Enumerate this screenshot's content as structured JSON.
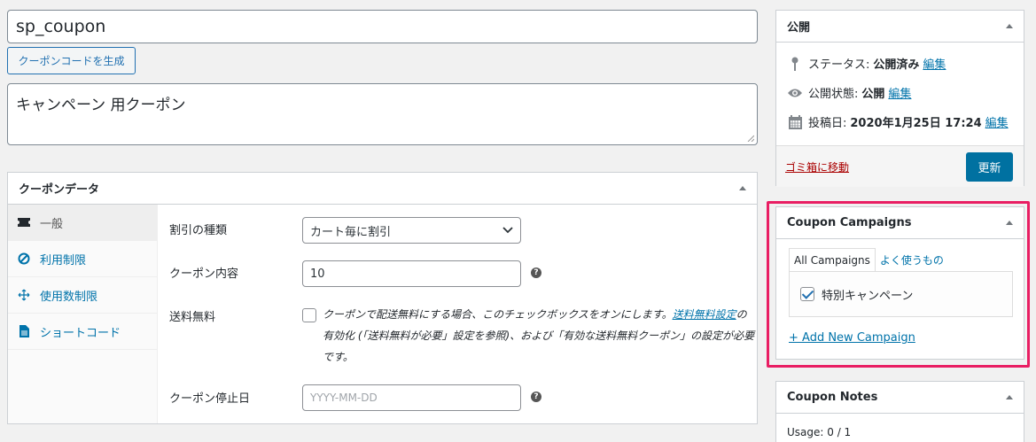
{
  "title_input": {
    "value": "sp_coupon"
  },
  "generate_button": {
    "label": "クーポンコードを生成"
  },
  "description": {
    "value": "キャンペーン 用クーポン"
  },
  "coupon_data": {
    "heading": "クーポンデータ",
    "tabs": [
      {
        "label": "一般",
        "icon": "ticket-icon"
      },
      {
        "label": "利用制限",
        "icon": "block-icon"
      },
      {
        "label": "使用数制限",
        "icon": "arrows-icon"
      },
      {
        "label": "ショートコード",
        "icon": "document-icon"
      }
    ],
    "fields": {
      "discount_type": {
        "label": "割引の種類",
        "value": "カート毎に割引"
      },
      "amount": {
        "label": "クーポン内容",
        "value": "10",
        "help": "?"
      },
      "free_shipping": {
        "label": "送料無料",
        "desc_before": "クーポンで配送無料にする場合、このチェックボックスをオンにします。",
        "desc_link": "送料無料設定",
        "desc_after": "の有効化 (「送料無料が必要」設定を参照)、および「有効な送料無料クーポン」の設定が必要です。"
      },
      "expiry": {
        "label": "クーポン停止日",
        "placeholder": "YYYY-MM-DD",
        "help": "?"
      }
    }
  },
  "publish": {
    "heading": "公開",
    "status": {
      "label": "ステータス:",
      "value": "公開済み",
      "edit": "編集"
    },
    "visibility": {
      "label": "公開状態:",
      "value": "公開",
      "edit": "編集"
    },
    "date": {
      "label": "投稿日:",
      "value": "2020年1月25日 17:24",
      "edit": "編集"
    },
    "trash": "ゴミ箱に移動",
    "update": "更新"
  },
  "coupon_campaigns": {
    "heading": "Coupon Campaigns",
    "tab_all": "All Campaigns",
    "tab_popular": "よく使うもの",
    "items": [
      {
        "label": "特別キャンペーン",
        "checked": true
      }
    ],
    "add_new": "+ Add New Campaign"
  },
  "coupon_notes": {
    "heading": "Coupon Notes",
    "usage": "Usage: 0 / 1"
  },
  "colors": {
    "accent": "#0073aa",
    "highlight": "#e91e63",
    "button": "#0071a1"
  }
}
